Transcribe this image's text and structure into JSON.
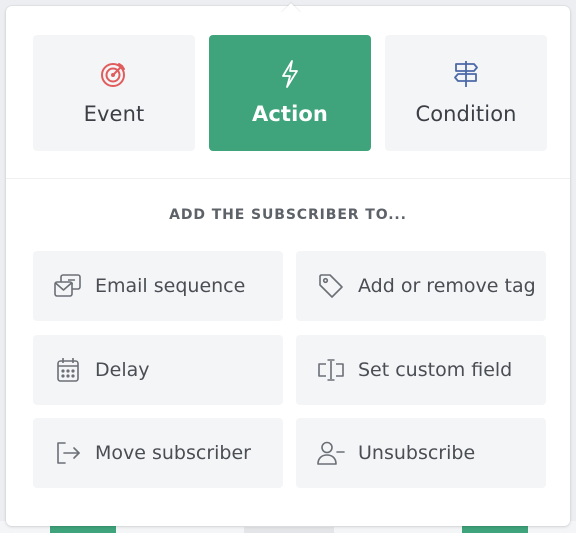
{
  "colors": {
    "accent": "#3fa37b",
    "event_icon": "#e05d5d",
    "condition_icon": "#4c6aa8",
    "option_icon": "#6b6f76",
    "card_bg": "#f4f5f7"
  },
  "step_types": [
    {
      "label": "Event",
      "icon": "target-icon",
      "active": false
    },
    {
      "label": "Action",
      "icon": "lightning-bolt-icon",
      "active": true
    },
    {
      "label": "Condition",
      "icon": "signpost-icon",
      "active": false
    }
  ],
  "section_heading": "ADD THE SUBSCRIBER TO...",
  "options": [
    {
      "label": "Email sequence",
      "icon": "email-sequence-icon"
    },
    {
      "label": "Add or remove tag",
      "icon": "tag-icon"
    },
    {
      "label": "Delay",
      "icon": "calendar-icon"
    },
    {
      "label": "Set custom field",
      "icon": "text-field-icon"
    },
    {
      "label": "Move subscriber",
      "icon": "move-icon"
    },
    {
      "label": "Unsubscribe",
      "icon": "user-minus-icon"
    }
  ]
}
